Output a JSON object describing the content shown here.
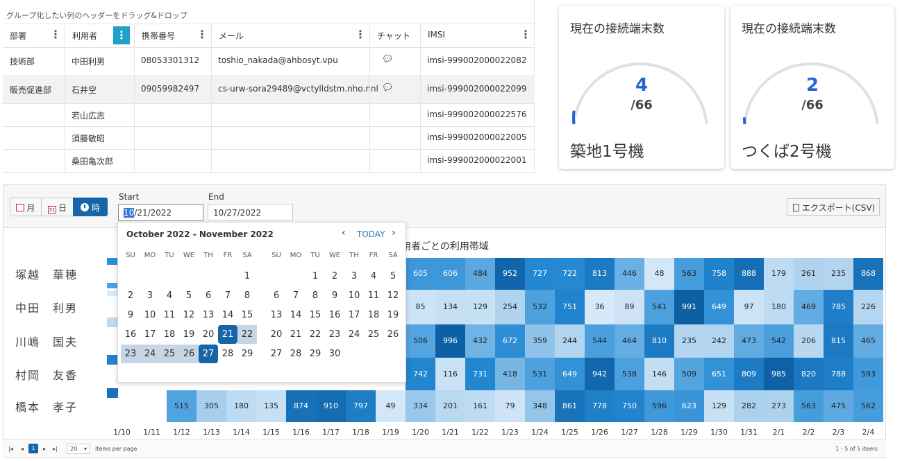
{
  "grid": {
    "group_prompt": "グループ化したい列のヘッダーをドラッグ&ドロップ",
    "columns": [
      "部署",
      "利用者",
      "携帯番号",
      "メール",
      "チャット",
      "IMSI"
    ],
    "menu_glyph": "⋮",
    "rows": [
      {
        "dept": "技術部",
        "user": "中田利男",
        "phone": "08053301312",
        "mail": "toshio_nakada@ahbosyt.vpu",
        "chat": "💬",
        "imsi": "imsi-999002000022082"
      },
      {
        "dept": "販売促進部",
        "user": "石井空",
        "phone": "09059982497",
        "mail": "cs-urw-sora29489@vctylldstm.nho.nnl",
        "chat": "💬",
        "imsi": "imsi-999002000022099"
      },
      {
        "dept": "",
        "user": "若山広志",
        "phone": "",
        "mail": "",
        "chat": "",
        "imsi": "imsi-999002000022576"
      },
      {
        "dept": "",
        "user": "須藤敏昭",
        "phone": "",
        "mail": "",
        "chat": "",
        "imsi": "imsi-999002000022005"
      },
      {
        "dept": "",
        "user": "桑田亀次郎",
        "phone": "",
        "mail": "",
        "chat": "",
        "imsi": "imsi-999002000022001"
      }
    ]
  },
  "cards": [
    {
      "title": "現在の接続端末数",
      "value": "4",
      "total": "/66",
      "name": "築地1号機",
      "fraction": 0.0606
    },
    {
      "title": "現在の接続端末数",
      "value": "2",
      "total": "/66",
      "name": "つくば2号機",
      "fraction": 0.0303
    }
  ],
  "scheduler": {
    "views": [
      {
        "label": "月",
        "icon": "calendar-month-icon"
      },
      {
        "label": "日",
        "icon": "calendar-day-icon",
        "icon_text": "31"
      },
      {
        "label": "時",
        "icon": "clock-icon"
      }
    ],
    "start_label": "Start",
    "start_value": "10/21/2022",
    "start_selected": "10",
    "end_label": "End",
    "end_value": "10/27/2022",
    "export_label": "エクスポート(CSV)",
    "heatmap_title": "用者ごとの利用帯域",
    "names": [
      "塚越　華穂",
      "中田　利男",
      "川嶋　国夫",
      "村岡　友香",
      "橋本　孝子"
    ],
    "dates": [
      "1/10",
      "1/11",
      "1/12",
      "1/13",
      "1/14",
      "1/15",
      "1/16",
      "1/17",
      "1/18",
      "1/19",
      "1/20",
      "1/21",
      "1/22",
      "1/23",
      "1/24",
      "1/25",
      "1/26",
      "1/27",
      "1/28",
      "1/29",
      "1/30",
      "1/31",
      "2/1",
      "2/2",
      "2/3",
      "2/4"
    ],
    "row_values": [
      [
        null,
        null,
        null,
        null,
        null,
        null,
        null,
        null,
        null,
        null,
        605,
        606,
        484,
        952,
        727,
        722,
        813,
        446,
        48,
        563,
        758,
        888,
        179,
        261,
        235,
        868
      ],
      [
        null,
        null,
        null,
        null,
        null,
        null,
        null,
        null,
        null,
        null,
        85,
        134,
        129,
        254,
        532,
        751,
        36,
        89,
        541,
        991,
        649,
        97,
        180,
        469,
        785,
        226
      ],
      [
        null,
        null,
        null,
        null,
        null,
        null,
        null,
        null,
        null,
        null,
        506,
        996,
        432,
        672,
        359,
        244,
        544,
        464,
        810,
        235,
        242,
        473,
        542,
        206,
        815,
        465
      ],
      [
        null,
        null,
        null,
        null,
        null,
        null,
        null,
        null,
        null,
        null,
        742,
        116,
        731,
        418,
        531,
        649,
        942,
        538,
        146,
        509,
        651,
        809,
        985,
        820,
        788,
        593
      ],
      [
        null,
        null,
        515,
        305,
        180,
        135,
        874,
        910,
        797,
        49,
        334,
        201,
        161,
        79,
        348,
        861,
        778,
        750,
        596,
        623,
        129,
        282,
        273,
        563,
        475,
        562
      ]
    ],
    "pager": {
      "current": "1",
      "page_size": "20",
      "per_page_label": "items per page",
      "summary": "1 - 5 of 5 items"
    }
  },
  "calendar": {
    "header": "October 2022 - November 2022",
    "today_label": "TODAY",
    "weekdays": [
      "SU",
      "MO",
      "TU",
      "WE",
      "TH",
      "FR",
      "SA"
    ],
    "months": [
      {
        "offset": 6,
        "days": [
          "1",
          "2",
          "3",
          "4",
          "5",
          "6",
          "7",
          "8",
          "9",
          "10",
          "11",
          "12",
          "13",
          "14",
          "15",
          "16",
          "17",
          "18",
          "19",
          "20",
          "21",
          "22",
          "23",
          "24",
          "25",
          "26",
          "27",
          "28",
          "29"
        ]
      },
      {
        "offset": 2,
        "days": [
          "1",
          "2",
          "3",
          "4",
          "5",
          "6",
          "7",
          "8",
          "9",
          "10",
          "11",
          "12",
          "13",
          "14",
          "15",
          "16",
          "17",
          "18",
          "19",
          "20",
          "21",
          "22",
          "23",
          "24",
          "25",
          "26",
          "27",
          "28",
          "29",
          "30"
        ]
      }
    ],
    "range_start": 21,
    "range_end": 27
  },
  "colors": {
    "accent": "#1565a8",
    "gauge_value": "#2365d8"
  }
}
